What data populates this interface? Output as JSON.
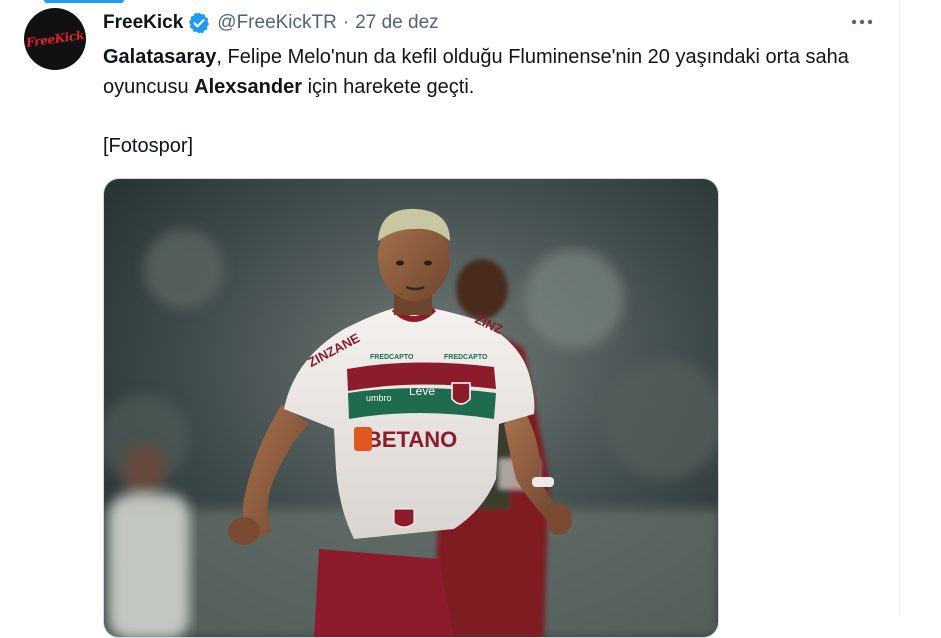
{
  "tweet": {
    "author": {
      "display_name": "FreeKick",
      "handle": "@FreeKickTR",
      "avatar_text": "FreeKick"
    },
    "separator": "·",
    "date": "27 de dez",
    "text": {
      "bold1": "Galatasaray",
      "part1": ", Felipe Melo'nun da kefil olduğu Fluminense'nin 20 yaşındaki orta saha oyuncusu ",
      "bold2": "Alexsander",
      "part2": " için harekete geçti."
    },
    "source": "[Fotospor]",
    "photo": {
      "sponsor": "BETANO",
      "brand_left": "ZINZANE",
      "brand_right": "ZINZ",
      "brand_umbro": "umbro",
      "brand_leve": "Leve",
      "patch": "FREDCAPTO"
    }
  },
  "colors": {
    "accent": "#1d9bf0",
    "text": "#0f1419",
    "muted": "#536471",
    "verified": "#1d9bf0",
    "jersey_maroon": "#8c1c2c",
    "jersey_green": "#1f6b4d"
  },
  "icons": {
    "verified": "verified-badge-icon",
    "more": "more-dots-icon"
  }
}
